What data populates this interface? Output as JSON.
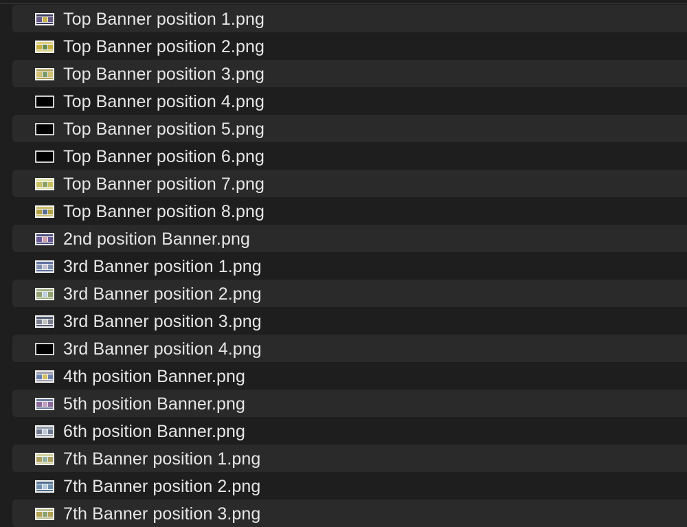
{
  "files": [
    {
      "name": "Top Banner position 1.png",
      "thumb": "image-thumbnail-icon"
    },
    {
      "name": "Top Banner position 2.png",
      "thumb": "image-thumbnail-icon"
    },
    {
      "name": "Top Banner position 3.png",
      "thumb": "image-thumbnail-icon"
    },
    {
      "name": "Top Banner position 4.png",
      "thumb": "blank-image-thumbnail-icon"
    },
    {
      "name": "Top Banner position 5.png",
      "thumb": "blank-image-thumbnail-icon"
    },
    {
      "name": "Top Banner position 6.png",
      "thumb": "blank-image-thumbnail-icon"
    },
    {
      "name": "Top Banner position 7.png",
      "thumb": "image-thumbnail-icon"
    },
    {
      "name": "Top Banner position 8.png",
      "thumb": "image-thumbnail-icon"
    },
    {
      "name": "2nd position Banner.png",
      "thumb": "image-thumbnail-icon"
    },
    {
      "name": "3rd Banner position 1.png",
      "thumb": "image-thumbnail-icon"
    },
    {
      "name": "3rd Banner position 2.png",
      "thumb": "image-thumbnail-icon"
    },
    {
      "name": "3rd Banner position 3.png",
      "thumb": "image-thumbnail-icon"
    },
    {
      "name": "3rd Banner position 4.png",
      "thumb": "blank-image-thumbnail-icon"
    },
    {
      "name": "4th position Banner.png",
      "thumb": "image-thumbnail-icon"
    },
    {
      "name": "5th position Banner.png",
      "thumb": "image-thumbnail-icon"
    },
    {
      "name": "6th position Banner.png",
      "thumb": "image-thumbnail-icon"
    },
    {
      "name": "7th Banner position 1.png",
      "thumb": "image-thumbnail-icon"
    },
    {
      "name": "7th Banner position 2.png",
      "thumb": "image-thumbnail-icon"
    },
    {
      "name": "7th Banner position 3.png",
      "thumb": "image-thumbnail-icon"
    }
  ],
  "colors": {
    "background": "#1e1e1e",
    "row_alt": "#2a2a2a",
    "text": "#e6e6e6"
  }
}
